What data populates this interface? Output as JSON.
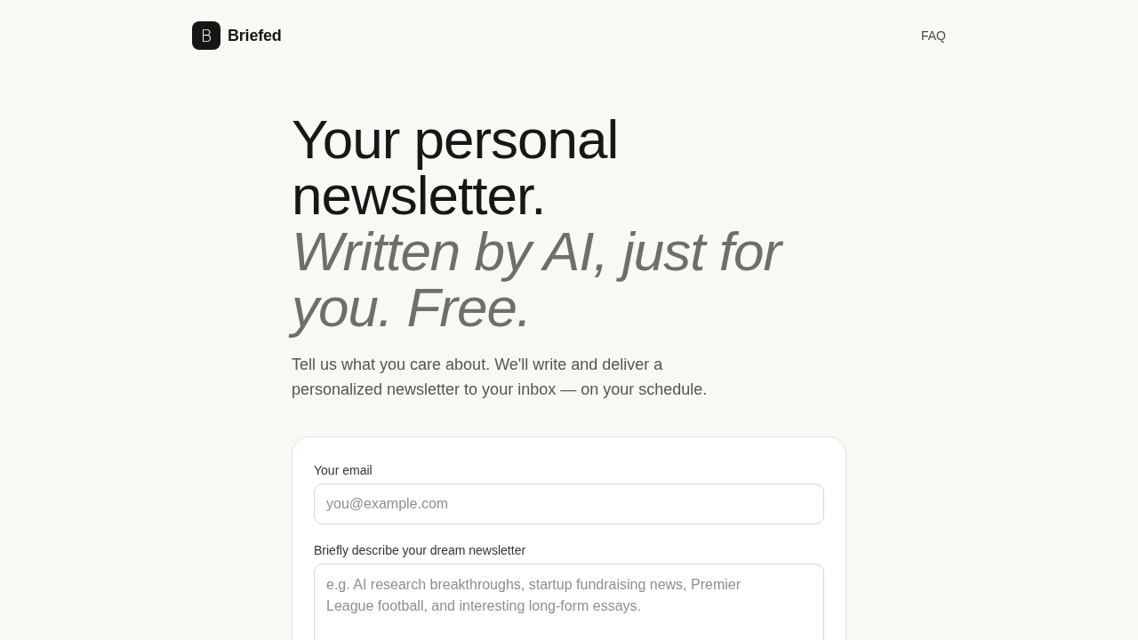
{
  "header": {
    "logo_letter": "B",
    "brand": "Briefed",
    "nav": [
      "FAQ"
    ]
  },
  "hero": {
    "title": "Your personal newsletter.",
    "subtitle": "Written by AI, just for you. Free.",
    "description": "Tell us what you care about. We'll write and deliver a personalized newsletter to your inbox — on your schedule."
  },
  "form": {
    "fields": [
      {
        "kind": "input",
        "label": "Your email",
        "placeholder": "you@example.com"
      },
      {
        "kind": "textarea",
        "label": "Briefly describe your dream newsletter",
        "placeholder": "e.g. AI research breakthroughs, startup fundraising news, Premier League football, and interesting long-form essays."
      }
    ]
  }
}
